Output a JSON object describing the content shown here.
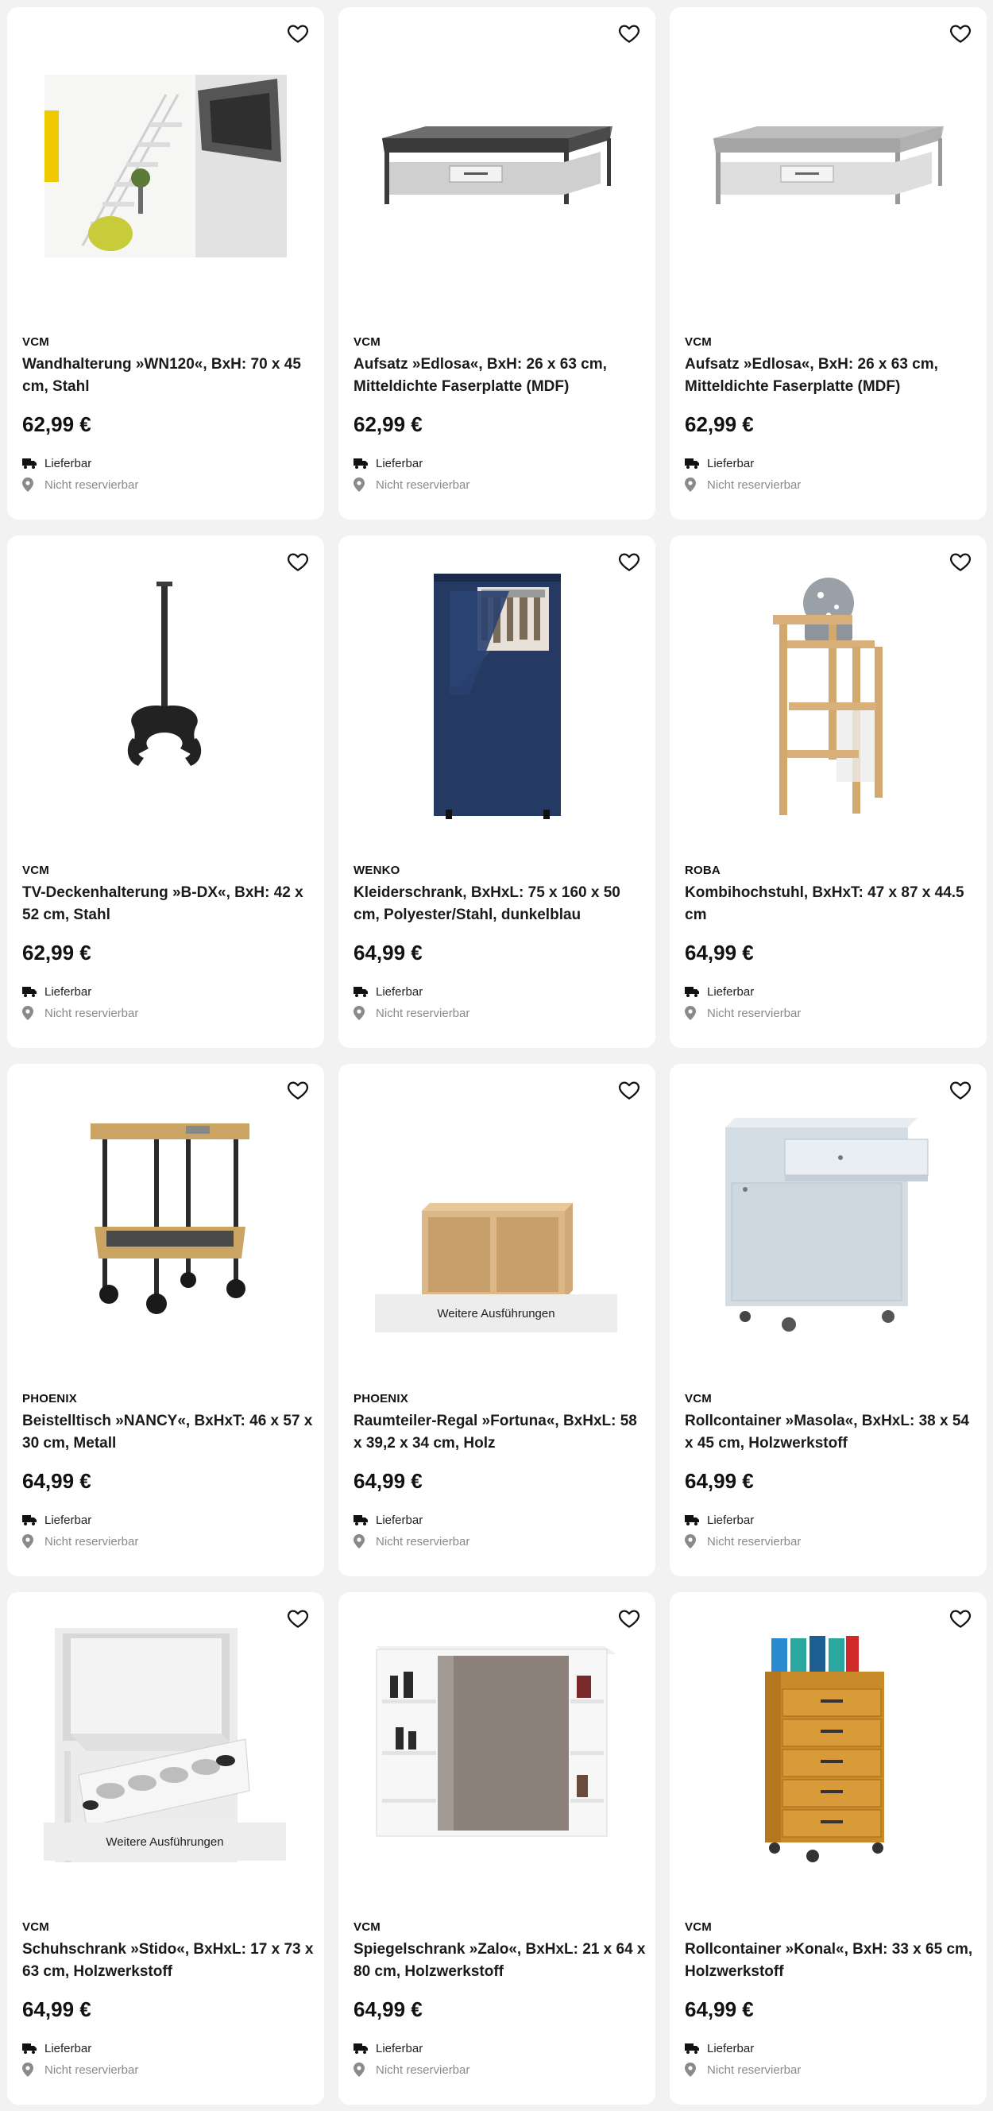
{
  "products": [
    {
      "brand": "VCM",
      "title": "Wandhalterung »WN120«, BxH: 70 x 45 cm, Stahl",
      "price": "62,99 €",
      "delivery": "Lieferbar",
      "reserve": "Nicht reservierbar"
    },
    {
      "brand": "VCM",
      "title": "Aufsatz »Edlosa«, BxH: 26 x 63 cm, Mitteldichte Faserplatte (MDF)",
      "price": "62,99 €",
      "delivery": "Lieferbar",
      "reserve": "Nicht reservierbar"
    },
    {
      "brand": "VCM",
      "title": "Aufsatz »Edlosa«, BxH: 26 x 63 cm, Mitteldichte Faserplatte (MDF)",
      "price": "62,99 €",
      "delivery": "Lieferbar",
      "reserve": "Nicht reservierbar"
    },
    {
      "brand": "VCM",
      "title": "TV-Deckenhalterung »B-DX«, BxH: 42 x 52 cm, Stahl",
      "price": "62,99 €",
      "delivery": "Lieferbar",
      "reserve": "Nicht reservierbar"
    },
    {
      "brand": "WENKO",
      "title": "Kleiderschrank, BxHxL: 75 x 160 x 50 cm, Polyester/Stahl, dunkelblau",
      "price": "64,99 €",
      "delivery": "Lieferbar",
      "reserve": "Nicht reservierbar"
    },
    {
      "brand": "ROBA",
      "title": "Kombihochstuhl, BxHxT: 47 x 87 x 44.5 cm",
      "price": "64,99 €",
      "delivery": "Lieferbar",
      "reserve": "Nicht reservierbar"
    },
    {
      "brand": "PHOENIX",
      "title": "Beistelltisch »NANCY«, BxHxT: 46 x 57 x 30 cm, Metall",
      "price": "64,99 €",
      "delivery": "Lieferbar",
      "reserve": "Nicht reservierbar"
    },
    {
      "brand": "PHOENIX",
      "title": "Raumteiler-Regal »Fortuna«, BxHxL: 58 x 39,2 x 34 cm, Holz",
      "price": "64,99 €",
      "delivery": "Lieferbar",
      "reserve": "Nicht reservierbar",
      "variants": "Weitere Ausführungen"
    },
    {
      "brand": "VCM",
      "title": "Rollcontainer »Masola«, BxHxL: 38 x 54 x 45 cm, Holzwerkstoff",
      "price": "64,99 €",
      "delivery": "Lieferbar",
      "reserve": "Nicht reservierbar"
    },
    {
      "brand": "VCM",
      "title": "Schuhschrank »Stido«, BxHxL: 17 x 73 x 63 cm, Holzwerkstoff",
      "price": "64,99 €",
      "delivery": "Lieferbar",
      "reserve": "Nicht reservierbar",
      "variants": "Weitere Ausführungen"
    },
    {
      "brand": "VCM",
      "title": "Spiegelschrank »Zalo«, BxHxL: 21 x 64 x 80 cm, Holzwerkstoff",
      "price": "64,99 €",
      "delivery": "Lieferbar",
      "reserve": "Nicht reservierbar"
    },
    {
      "brand": "VCM",
      "title": "Rollcontainer »Konal«, BxH: 33 x 65 cm, Holzwerkstoff",
      "price": "64,99 €",
      "delivery": "Lieferbar",
      "reserve": "Nicht reservierbar"
    }
  ],
  "icons": {
    "favorite": "heart-outline-icon",
    "delivery": "truck-icon",
    "reserve": "location-pin-icon"
  },
  "colors": {
    "background": "#f2f2f2",
    "card": "#ffffff",
    "muted_text": "#8a8a8a"
  }
}
